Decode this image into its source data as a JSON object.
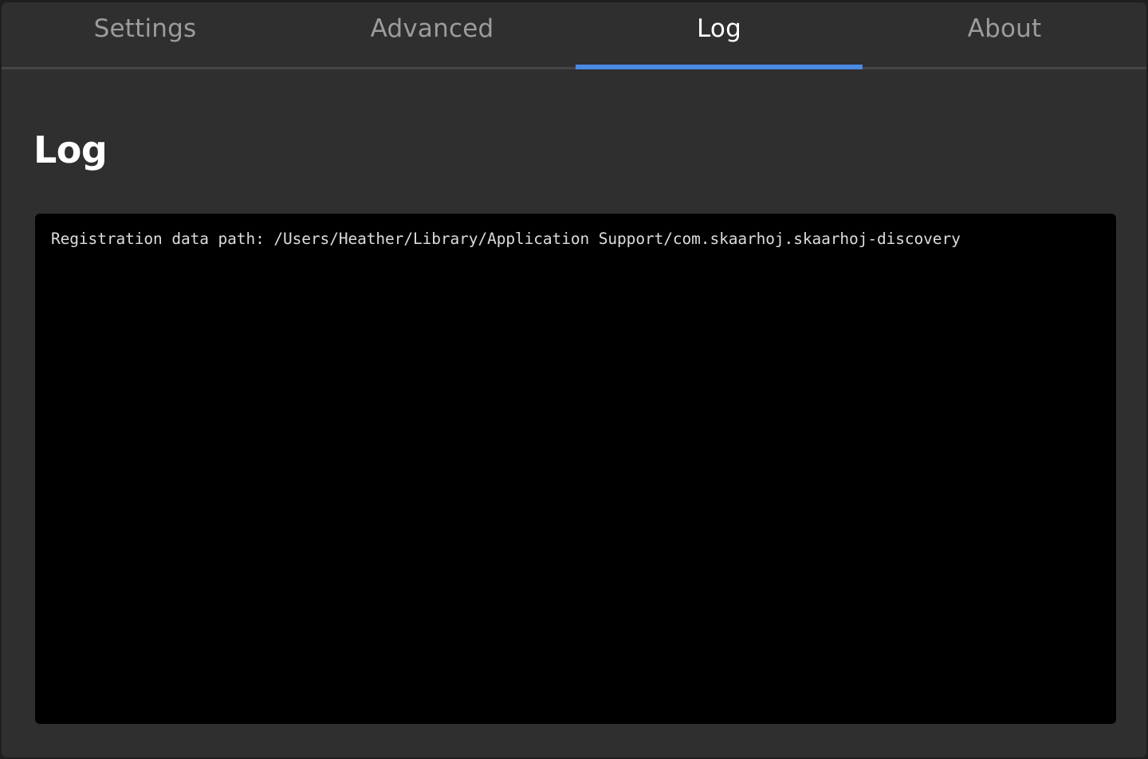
{
  "tabs": [
    {
      "label": "Settings",
      "active": false
    },
    {
      "label": "Advanced",
      "active": false
    },
    {
      "label": "Log",
      "active": true
    },
    {
      "label": "About",
      "active": false
    }
  ],
  "colors": {
    "accent": "#4a8ae5",
    "window_background": "#2f2f2f",
    "console_background": "#000000"
  },
  "page": {
    "title": "Log"
  },
  "log": {
    "lines": [
      "Registration data path: /Users/Heather/Library/Application Support/com.skaarhoj.skaarhoj-discovery"
    ]
  }
}
